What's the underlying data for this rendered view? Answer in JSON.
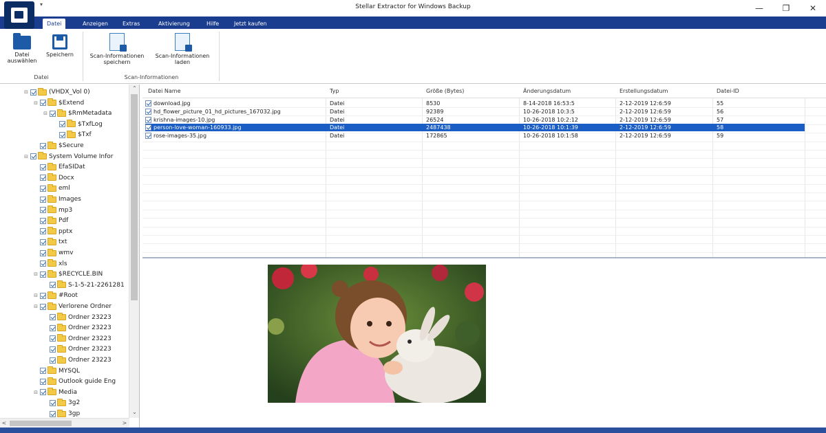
{
  "window": {
    "title": "Stellar Extractor for Windows Backup",
    "minimize": "—",
    "maximize": "❐",
    "close": "✕"
  },
  "ribbon_tabs": [
    {
      "label": "Datei",
      "active": true
    },
    {
      "label": "Anzeigen"
    },
    {
      "label": "Extras"
    },
    {
      "label": "Aktivierung"
    },
    {
      "label": "Hilfe"
    },
    {
      "label": "Jetzt kaufen"
    }
  ],
  "ribbon": {
    "buttons": {
      "select_file_1": "Datei",
      "select_file_2": "auswählen",
      "save": "Speichern",
      "save_scan_1": "Scan-Informationen",
      "save_scan_2": "speichern",
      "load_scan_1": "Scan-Informationen",
      "load_scan_2": "laden"
    },
    "groups": {
      "file": "Datei",
      "scan": "Scan-Informationen"
    }
  },
  "tree": {
    "items": [
      {
        "label": "(VHDX_Vol 0)",
        "expander": "⊟"
      },
      {
        "label": "$Extend",
        "expander": "⊟"
      },
      {
        "label": "$RmMetadata",
        "expander": "⊟"
      },
      {
        "label": "$TxfLog",
        "expander": ""
      },
      {
        "label": "$Txf",
        "expander": ""
      },
      {
        "label": "$Secure",
        "expander": ""
      },
      {
        "label": "System Volume Infor",
        "expander": "⊟"
      },
      {
        "label": "EfaSIDat",
        "expander": ""
      },
      {
        "label": "Docx",
        "expander": ""
      },
      {
        "label": "eml",
        "expander": ""
      },
      {
        "label": "Images",
        "expander": ""
      },
      {
        "label": "mp3",
        "expander": ""
      },
      {
        "label": "Pdf",
        "expander": ""
      },
      {
        "label": "pptx",
        "expander": ""
      },
      {
        "label": "txt",
        "expander": ""
      },
      {
        "label": "wmv",
        "expander": ""
      },
      {
        "label": "xls",
        "expander": ""
      },
      {
        "label": "$RECYCLE.BIN",
        "expander": "⊟"
      },
      {
        "label": "S-1-5-21-2261281",
        "expander": ""
      },
      {
        "label": "#Root",
        "expander": "⊟"
      },
      {
        "label": "Verlorene Ordner",
        "expander": "⊟"
      },
      {
        "label": "Ordner 23223",
        "expander": ""
      },
      {
        "label": "Ordner 23223",
        "expander": ""
      },
      {
        "label": "Ordner 23223",
        "expander": ""
      },
      {
        "label": "Ordner 23223",
        "expander": ""
      },
      {
        "label": "Ordner 23223",
        "expander": ""
      },
      {
        "label": "MYSQL",
        "expander": ""
      },
      {
        "label": "Outlook guide Eng",
        "expander": ""
      },
      {
        "label": "Media",
        "expander": "⊟"
      },
      {
        "label": "3g2",
        "expander": ""
      },
      {
        "label": "3gp",
        "expander": ""
      }
    ],
    "scroll_up": "⌃",
    "scroll_down": "⌄",
    "scroll_left": "<",
    "scroll_right": ">"
  },
  "file_list": {
    "columns": [
      "Datei Name",
      "Typ",
      "Größe (Bytes)",
      "Änderungsdatum",
      "Erstellungsdatum",
      "Datei-ID"
    ],
    "rows": [
      {
        "name": "download.jpg",
        "type": "Datei",
        "size": "8530",
        "modified": "8-14-2018 16:53:5",
        "created": "2-12-2019 12:6:59",
        "id": "55",
        "selected": false
      },
      {
        "name": "hd_flower_picture_01_hd_pictures_167032.jpg",
        "type": "Datei",
        "size": "92389",
        "modified": "10-26-2018 10:3:5",
        "created": "2-12-2019 12:6:59",
        "id": "56",
        "selected": false
      },
      {
        "name": "krishna-images-10.jpg",
        "type": "Datei",
        "size": "26524",
        "modified": "10-26-2018 10:2:12",
        "created": "2-12-2019 12:6:59",
        "id": "57",
        "selected": false
      },
      {
        "name": "person-love-woman-160933.jpg",
        "type": "Datei",
        "size": "2487438",
        "modified": "10-26-2018 10:1:39",
        "created": "2-12-2019 12:6:59",
        "id": "58",
        "selected": true
      },
      {
        "name": "rose-images-35.jpg",
        "type": "Datei",
        "size": "172865",
        "modified": "10-26-2018 10:1:58",
        "created": "2-12-2019 12:6:59",
        "id": "59",
        "selected": false
      }
    ]
  },
  "colors": {
    "accent": "#1b3d8f",
    "selection": "#1a5dc4",
    "folder": "#f3c948"
  }
}
